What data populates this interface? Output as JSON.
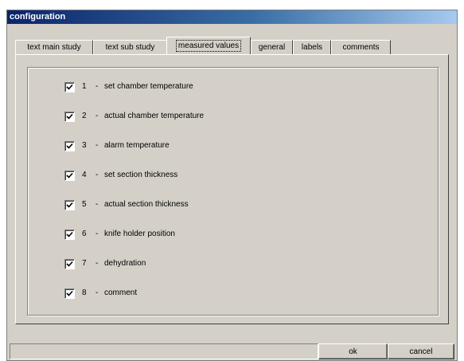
{
  "window": {
    "title": "configuration"
  },
  "tabs": [
    {
      "label": "text main study",
      "active": false
    },
    {
      "label": "text sub study",
      "active": false
    },
    {
      "label": "measured values",
      "active": true
    },
    {
      "label": "general",
      "active": false
    },
    {
      "label": "labels",
      "active": false
    },
    {
      "label": "comments",
      "active": false
    }
  ],
  "measured_values": [
    {
      "number": "1",
      "label": "set chamber temperature",
      "checked": true
    },
    {
      "number": "2",
      "label": "actual chamber temperature",
      "checked": true
    },
    {
      "number": "3",
      "label": "alarm temperature",
      "checked": true
    },
    {
      "number": "4",
      "label": "set section thickness",
      "checked": true
    },
    {
      "number": "5",
      "label": "actual section thickness",
      "checked": true
    },
    {
      "number": "6",
      "label": "knife holder position",
      "checked": true
    },
    {
      "number": "7",
      "label": "dehydration",
      "checked": true
    },
    {
      "number": "8",
      "label": "comment",
      "checked": true
    }
  ],
  "separator": "-",
  "buttons": {
    "ok": "ok",
    "cancel": "cancel"
  },
  "colors": {
    "dialog_bg": "#d4d0c8",
    "title_start": "#0a246a",
    "title_end": "#a6caf0"
  }
}
